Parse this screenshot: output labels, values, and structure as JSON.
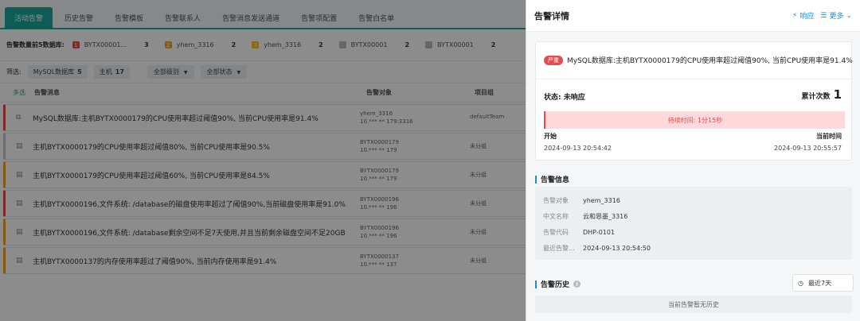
{
  "tabs": [
    {
      "label": "活动告警",
      "active": true
    },
    {
      "label": "历史告警"
    },
    {
      "label": "告警模板"
    },
    {
      "label": "告警联系人"
    },
    {
      "label": "告警消息发送通道"
    },
    {
      "label": "告警项配置"
    },
    {
      "label": "告警白名单"
    }
  ],
  "stats": {
    "label": "告警数量前5数据库:",
    "items": [
      {
        "sev": "1",
        "color": "red",
        "name": "BYTX00001...",
        "count": "3"
      },
      {
        "sev": "2",
        "color": "orange",
        "name": "yhem_3316",
        "count": "2"
      },
      {
        "sev": "3",
        "color": "yellow",
        "name": "yhem_3316",
        "count": "2"
      },
      {
        "sev": "",
        "color": "gray",
        "name": "BYTX00001",
        "count": "2"
      },
      {
        "sev": "",
        "color": "gray",
        "name": "BYTX00001",
        "count": "2"
      }
    ]
  },
  "filters": {
    "label": "筛选:",
    "chips": [
      {
        "label": "MySQL数据库",
        "count": "5"
      },
      {
        "label": "主机",
        "count": "17"
      }
    ],
    "level_select": "全部级别",
    "status_select": "全部状态"
  },
  "table": {
    "multi": "多选",
    "col_msg": "告警消息",
    "col_obj": "告警对象",
    "col_proj": "项目组",
    "rows": [
      {
        "sev": "red",
        "icon": "database-icon",
        "msg": "MySQL数据库:主机BYTX0000179的CPU使用率超过阈值90%, 当前CPU使用率是91.4%",
        "obj1": "yhem_3316",
        "obj2": "10.*** ** 179:3316",
        "proj": "defaultTeam"
      },
      {
        "sev": "gray",
        "icon": "host-icon",
        "msg": "主机BYTX0000179的CPU使用率超过阈值80%, 当前CPU使用率是90.5%",
        "obj1": "BYTX0000179",
        "obj2": "10.*** ** 179",
        "proj": "未分组"
      },
      {
        "sev": "orange",
        "icon": "host-icon",
        "msg": "主机BYTX0000179的CPU使用率超过阈值60%, 当前CPU使用率是84.5%",
        "obj1": "BYTX0000179",
        "obj2": "10.*** ** 179",
        "proj": "未分组"
      },
      {
        "sev": "red",
        "icon": "host-icon",
        "msg": "主机BYTX0000196,文件系统: /database的磁盘使用率超过了阈值90%,当前磁盘使用率是91.0%",
        "obj1": "BYTX0000196",
        "obj2": "10.*** ** 196",
        "proj": "未分组"
      },
      {
        "sev": "orange",
        "icon": "host-icon",
        "msg": "主机BYTX0000196,文件系统: /database剩余空间不足7天使用,并且当前剩余磁盘空间不足20GB",
        "obj1": "BYTX0000196",
        "obj2": "10.*** ** 196",
        "proj": "未分组"
      },
      {
        "sev": "orange",
        "icon": "host-icon",
        "msg": "主机BYTX0000137的内存使用率超过了阈值90%, 当前内存使用率是91.4%",
        "obj1": "BYTX0000137",
        "obj2": "10.*** ** 137",
        "proj": "未分组"
      }
    ]
  },
  "drawer": {
    "title": "告警详情",
    "respond_label": "响应",
    "more_label": "更多",
    "severity_badge": "严重",
    "alert_title": "MySQL数据库:主机BYTX0000179的CPU使用率超过阈值90%, 当前CPU使用率是91.4%",
    "status_label": "状态: 未响应",
    "count_label": "累计次数",
    "count_value": "1",
    "duration": "持续时间: 1分15秒",
    "start_label": "开始",
    "now_label": "当前时间",
    "start_time": "2024-09-13 20:54:42",
    "now_time": "2024-09-13 20:55:57",
    "info_title": "告警信息",
    "info": [
      {
        "k": "告警对象",
        "v": "yhem_3316"
      },
      {
        "k": "中文名称",
        "v": "云和恩墨_3316"
      },
      {
        "k": "告警代码",
        "v": "DHP-0101"
      },
      {
        "k": "最近告警...",
        "v": "2024-09-13 20:54:50"
      }
    ],
    "history_title": "告警历史",
    "range_label": "最近7天",
    "empty_text": "当前告警暂无历史"
  },
  "colors": {
    "accent": "#1aa89b",
    "critical": "#e84b4b",
    "link": "#1a8fd8"
  }
}
